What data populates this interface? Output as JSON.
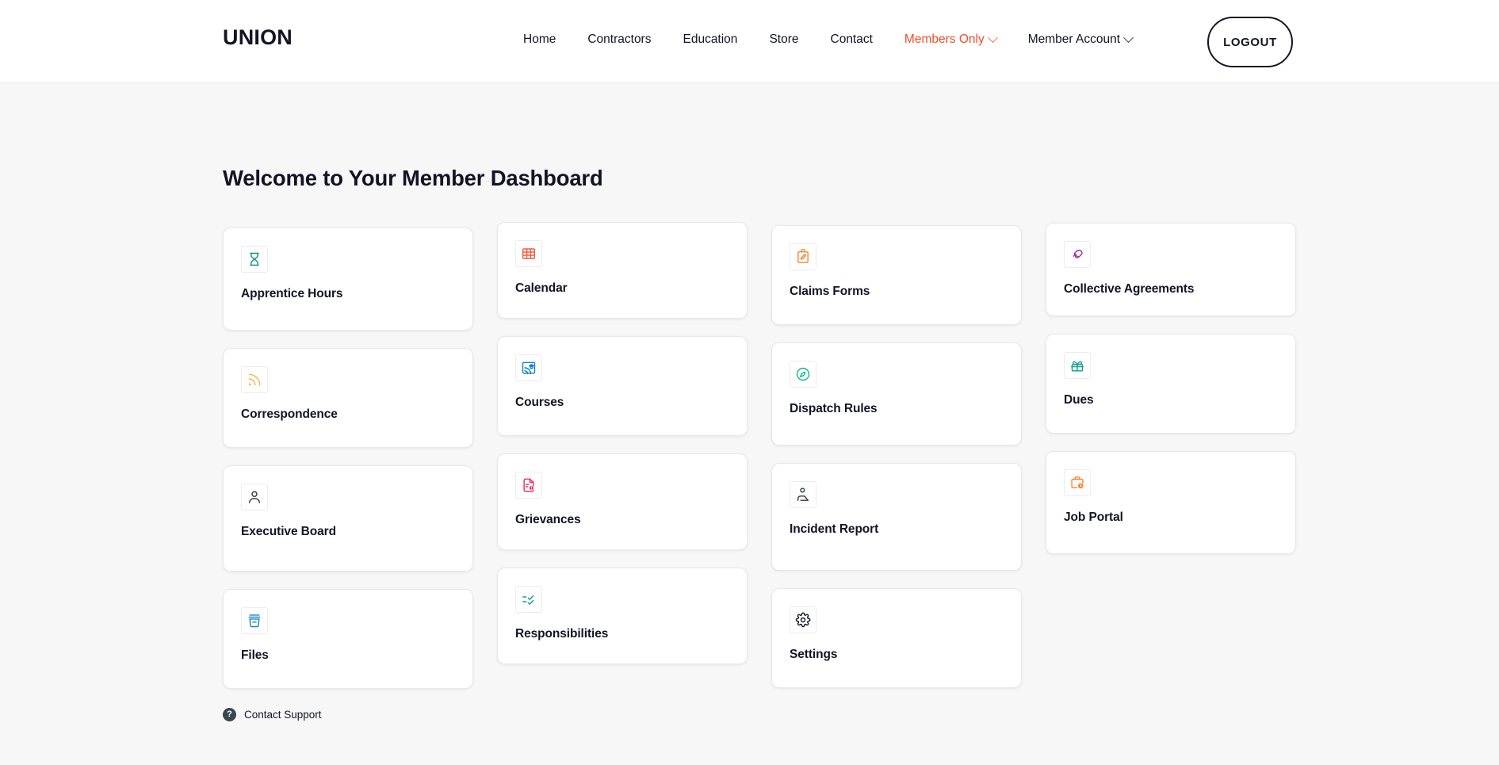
{
  "header": {
    "brand": "UNION",
    "nav": [
      {
        "label": "Home",
        "accent": false,
        "caret": false
      },
      {
        "label": "Contractors",
        "accent": false,
        "caret": false
      },
      {
        "label": "Education",
        "accent": false,
        "caret": false
      },
      {
        "label": "Store",
        "accent": false,
        "caret": false
      },
      {
        "label": "Contact",
        "accent": false,
        "caret": false
      },
      {
        "label": "Members Only",
        "accent": true,
        "caret": true
      },
      {
        "label": "Member Account",
        "accent": false,
        "caret": true
      }
    ],
    "logout_label": "LOGOUT",
    "accent_color": "#f44c25",
    "text_color": "#131426"
  },
  "main": {
    "title": "Welcome to Your Member Dashboard",
    "columns": [
      {
        "cards": [
          {
            "label": "Apprentice Hours",
            "icon": "hourglass-icon",
            "color": "#0d9488",
            "height": "h-130"
          },
          {
            "label": "Correspondence",
            "icon": "rss-feed-icon",
            "color": "#f5b54a",
            "height": "h-126"
          },
          {
            "label": "Executive Board",
            "icon": "person-icon",
            "color": "#2b3a41",
            "height": "h-134"
          },
          {
            "label": "Files",
            "icon": "archive-box-icon",
            "color": "#1283c3",
            "height": "h-126"
          }
        ]
      },
      {
        "cards": [
          {
            "label": "Calendar",
            "icon": "calendar-grid-icon",
            "color": "#ef5d3c",
            "height": "h-122"
          },
          {
            "label": "Courses",
            "icon": "online-course-icon",
            "color": "#1283c3",
            "height": "h-126"
          },
          {
            "label": "Grievances",
            "icon": "document-alert-icon",
            "color": "#ef2b56",
            "height": "h-122"
          },
          {
            "label": "Responsibilities",
            "icon": "checklist-icon",
            "color": "#129b8e",
            "height": "h-122"
          }
        ]
      },
      {
        "cards": [
          {
            "label": "Claims Forms",
            "icon": "clipboard-pencil-icon",
            "color": "#f58634",
            "height": "h-126"
          },
          {
            "label": "Dispatch Rules",
            "icon": "compass-icon",
            "color": "#0fb98a",
            "height": "h-130"
          },
          {
            "label": "Incident Report",
            "icon": "injured-person-icon",
            "color": "#2b3a41",
            "height": "h-136"
          },
          {
            "label": "Settings",
            "icon": "gear-icon",
            "color": "#131426",
            "height": "h-126"
          }
        ]
      },
      {
        "cards": [
          {
            "label": "Collective Agreements",
            "icon": "handshake-icon",
            "color": "#9c3496",
            "height": "h-118"
          },
          {
            "label": "Dues",
            "icon": "gift-box-icon",
            "color": "#129b8e",
            "height": "h-126"
          },
          {
            "label": "Job Portal",
            "icon": "briefcase-clock-icon",
            "color": "#f58634",
            "height": "h-130"
          }
        ]
      }
    ],
    "support": {
      "badge": "?",
      "label": "Contact Support"
    }
  }
}
